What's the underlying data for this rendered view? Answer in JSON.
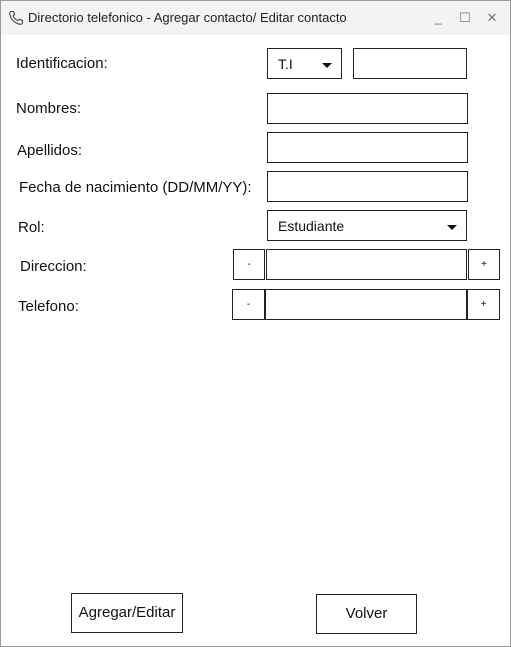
{
  "window": {
    "title": "Directorio telefonico - Agregar contacto/ Editar contacto",
    "minimize_label": "_",
    "maximize_label": "☐",
    "close_label": "✕"
  },
  "form": {
    "identificacion": {
      "label": "Identificacion:",
      "type_selected": "T.I",
      "value": ""
    },
    "nombres": {
      "label": "Nombres:",
      "value": ""
    },
    "apellidos": {
      "label": "Apellidos:",
      "value": ""
    },
    "fecha": {
      "label": "Fecha de nacimiento (DD/MM/YY):",
      "value": ""
    },
    "rol": {
      "label": "Rol:",
      "selected": "Estudiante"
    },
    "direccion": {
      "label": "Direccion:",
      "value": "",
      "minus": "-",
      "plus": "+"
    },
    "telefono": {
      "label": "Telefono:",
      "value": "",
      "minus": "-",
      "plus": "+"
    }
  },
  "actions": {
    "submit_label": "Agregar/Editar",
    "back_label": "Volver"
  }
}
